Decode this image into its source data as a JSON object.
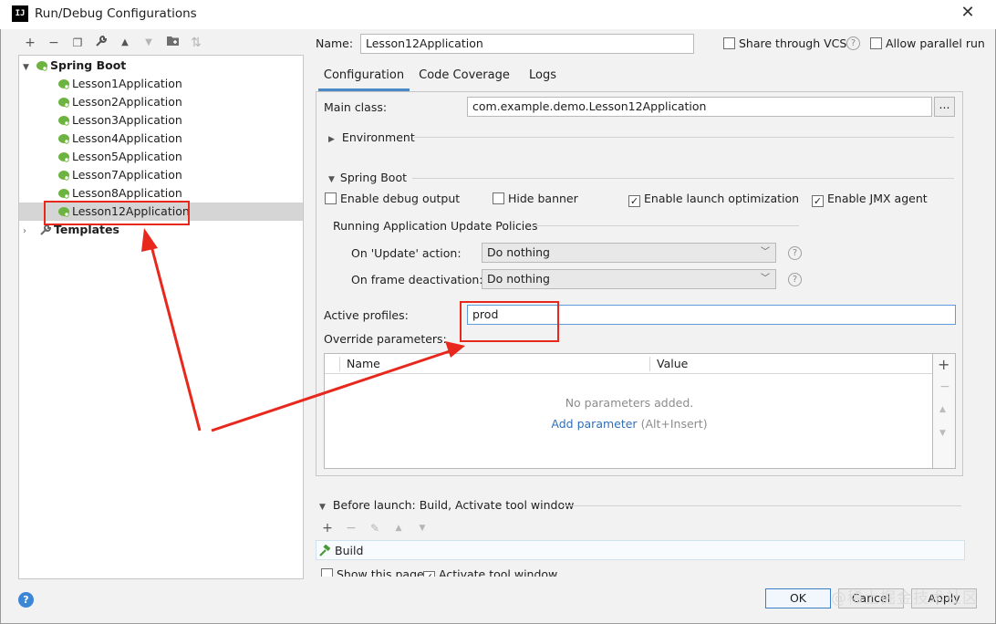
{
  "window": {
    "title": "Run/Debug Configurations",
    "app_icon": "IJ",
    "close_icon": "✕"
  },
  "toolbar_icons": [
    {
      "name": "add-icon",
      "glyph": "+"
    },
    {
      "name": "remove-icon",
      "glyph": "−"
    },
    {
      "name": "copy-icon",
      "glyph": "❐"
    },
    {
      "name": "wrench-icon",
      "glyph": "🔧"
    },
    {
      "name": "move-up-icon",
      "glyph": "▲"
    },
    {
      "name": "move-down-icon",
      "glyph": "▼"
    },
    {
      "name": "folder-icon",
      "glyph": "📁"
    },
    {
      "name": "sort-icon",
      "glyph": "⇅"
    }
  ],
  "tree": {
    "root": "Spring Boot",
    "items": [
      "Lesson1Application",
      "Lesson2Application",
      "Lesson3Application",
      "Lesson4Application",
      "Lesson5Application",
      "Lesson7Application",
      "Lesson8Application",
      "Lesson12Application"
    ],
    "selected": "Lesson12Application",
    "templates": "Templates"
  },
  "header": {
    "name_label": "Name:",
    "name_value": "Lesson12Application",
    "share_label": "Share through VCS",
    "parallel_label": "Allow parallel run"
  },
  "tabs": [
    "Configuration",
    "Code Coverage",
    "Logs"
  ],
  "config": {
    "main_class_label": "Main class:",
    "main_class_value": "com.example.demo.Lesson12Application",
    "browse_label": "...",
    "environment_label": "Environment",
    "spring_boot_label": "Spring Boot",
    "checks": [
      {
        "label": "Enable debug output",
        "checked": false
      },
      {
        "label": "Hide banner",
        "checked": false
      },
      {
        "label": "Enable launch optimization",
        "checked": true
      },
      {
        "label": "Enable JMX agent",
        "checked": true
      }
    ],
    "update_policies_label": "Running Application Update Policies",
    "update_action_label": "On 'Update' action:",
    "update_action_value": "Do nothing",
    "frame_deactivation_label": "On frame deactivation:",
    "frame_deactivation_value": "Do nothing",
    "active_profiles_label": "Active profiles:",
    "active_profiles_value": "prod",
    "override_label": "Override parameters:",
    "table_headers": [
      "Name",
      "Value"
    ],
    "empty_text": "No parameters added.",
    "add_parameter_link": "Add parameter",
    "add_parameter_shortcut": "(Alt+Insert)"
  },
  "before_launch": {
    "label": "Before launch: Build, Activate tool window",
    "task": "Build",
    "show_page": "Show this page",
    "activate_tool_window": "Activate tool window"
  },
  "buttons": {
    "ok": "OK",
    "cancel": "Cancel",
    "apply": "Apply"
  },
  "watermark": "@稀土掘金技术社区",
  "colors": {
    "accent": "#4a88c7",
    "link": "#2f6fb8",
    "annotation_red": "#e8281d",
    "selection": "#d5d5d5"
  }
}
